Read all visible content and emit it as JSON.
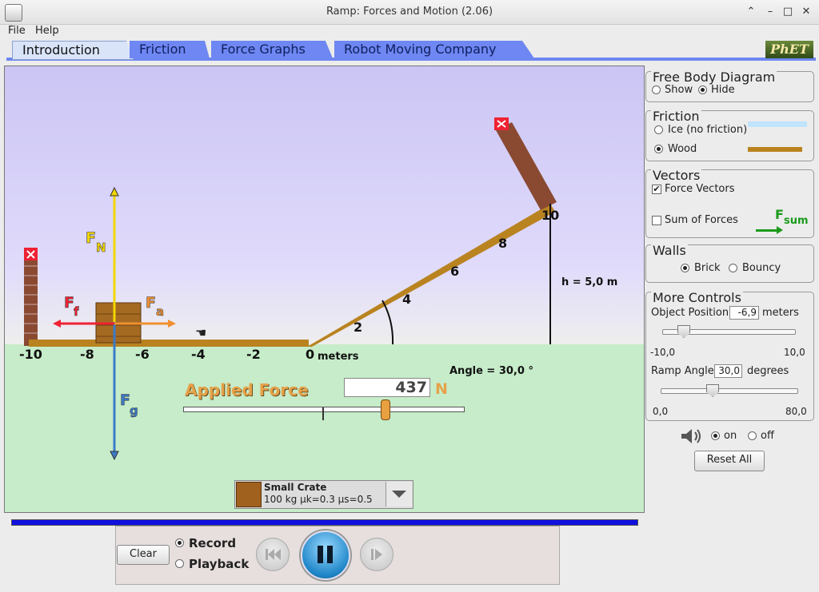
{
  "window": {
    "title": "Ramp: Forces and Motion (2.06)"
  },
  "menu": [
    "File",
    "Help"
  ],
  "tabs": [
    "Introduction",
    "Friction",
    "Force Graphs",
    "Robot Moving Company"
  ],
  "active_tab": "Introduction",
  "logo_text": "PhET",
  "scene": {
    "axis_ticks": [
      "-10",
      "-8",
      "-6",
      "-4",
      "-2",
      "0"
    ],
    "axis_unit": "meters",
    "ramp_ticks": [
      "2",
      "4",
      "6",
      "8",
      "10"
    ],
    "height_label": "h = 5,0 m",
    "angle_label": "Angle = 30,0 °",
    "force_labels": {
      "normal": "F",
      "normal_sub": "N",
      "friction": "F",
      "friction_sub": "f",
      "applied": "F",
      "applied_sub": "a",
      "gravity": "F",
      "gravity_sub": "g"
    }
  },
  "applied_force": {
    "label": "Applied Force",
    "value": "437",
    "unit": "N"
  },
  "object_chooser": {
    "name": "Small Crate",
    "specs": "100 kg μk=0.3 μs=0.5"
  },
  "panels": {
    "free_body": {
      "title": "Free Body Diagram",
      "options": [
        "Show",
        "Hide"
      ],
      "selected": "Hide"
    },
    "friction": {
      "title": "Friction",
      "options": [
        "Ice (no friction)",
        "Wood"
      ],
      "selected": "Wood"
    },
    "vectors": {
      "title": "Vectors",
      "force_vectors": "Force Vectors",
      "force_vectors_checked": true,
      "sum_of_forces": "Sum of Forces",
      "sum_of_forces_checked": false,
      "fsum": "F",
      "fsum_sub": "sum"
    },
    "walls": {
      "title": "Walls",
      "options": [
        "Brick",
        "Bouncy"
      ],
      "selected": "Brick"
    },
    "more_controls": {
      "title": "More Controls",
      "object_position_label": "Object Position",
      "object_position_value": "-6,9",
      "object_position_unit": "meters",
      "position_min": "-10,0",
      "position_max": "10,0",
      "ramp_angle_label": "Ramp Angle",
      "ramp_angle_value": "30,0",
      "ramp_angle_unit": "degrees",
      "angle_min": "0,0",
      "angle_max": "80,0"
    }
  },
  "sound": {
    "on": "on",
    "off": "off",
    "selected": "on"
  },
  "reset_all": "Reset All",
  "playback": {
    "clear": "Clear",
    "record": "Record",
    "playback": "Playback",
    "selected": "Record"
  }
}
